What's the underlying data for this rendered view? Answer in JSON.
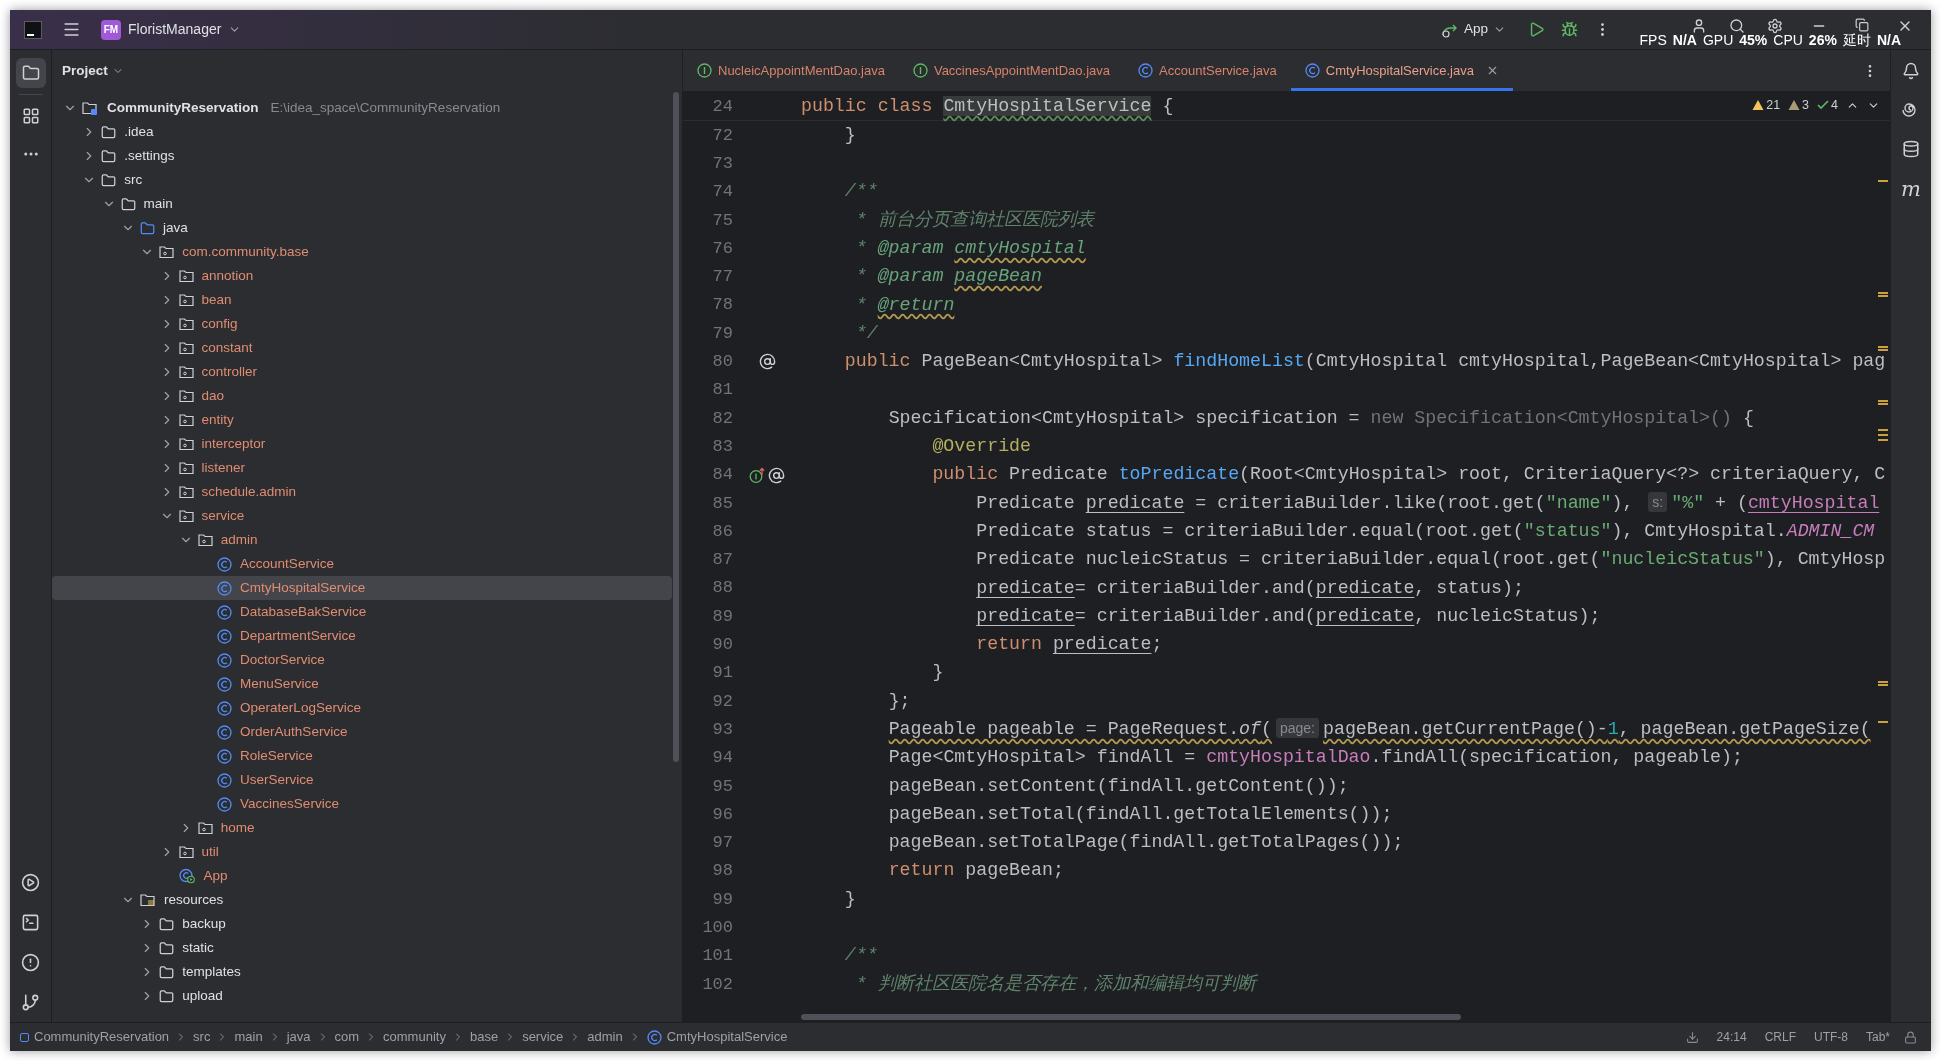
{
  "title_bar": {
    "project_badge": "FM",
    "project_name": "FloristManager",
    "run_config": "App"
  },
  "perf_overlay": [
    {
      "label": "FPS",
      "value": "N/A"
    },
    {
      "label": "GPU",
      "value": "45%"
    },
    {
      "label": "CPU",
      "value": "26%"
    },
    {
      "label": "延时",
      "value": "N/A"
    }
  ],
  "project_panel": {
    "title": "Project",
    "tree": [
      {
        "name": "CommunityReservation",
        "path": "E:\\idea_space\\CommunityReservation",
        "kind": "module",
        "color": "#dfe1e5",
        "expanded": true,
        "selected": false,
        "children": [
          {
            "name": ".idea",
            "kind": "folder",
            "color": "#dfe1e5",
            "expanded": false,
            "selected": false
          },
          {
            "name": ".settings",
            "kind": "folder",
            "color": "#dfe1e5",
            "expanded": false,
            "selected": false
          },
          {
            "name": "src",
            "kind": "folder",
            "color": "#dfe1e5",
            "expanded": true,
            "selected": false,
            "children": [
              {
                "name": "main",
                "kind": "folder",
                "color": "#dfe1e5",
                "expanded": true,
                "selected": false,
                "children": [
                  {
                    "name": "java",
                    "kind": "source-root",
                    "color": "#dfe1e5",
                    "expanded": true,
                    "selected": false,
                    "children": [
                      {
                        "name": "com.community.base",
                        "kind": "package",
                        "color": "#e08c73",
                        "expanded": true,
                        "selected": false,
                        "children": [
                          {
                            "name": "annotion",
                            "kind": "package",
                            "color": "#e08c73",
                            "expanded": false,
                            "selected": false
                          },
                          {
                            "name": "bean",
                            "kind": "package",
                            "color": "#e08c73",
                            "expanded": false,
                            "selected": false
                          },
                          {
                            "name": "config",
                            "kind": "package",
                            "color": "#e08c73",
                            "expanded": false,
                            "selected": false
                          },
                          {
                            "name": "constant",
                            "kind": "package",
                            "color": "#e08c73",
                            "expanded": false,
                            "selected": false
                          },
                          {
                            "name": "controller",
                            "kind": "package",
                            "color": "#e08c73",
                            "expanded": false,
                            "selected": false
                          },
                          {
                            "name": "dao",
                            "kind": "package",
                            "color": "#e08c73",
                            "expanded": false,
                            "selected": false
                          },
                          {
                            "name": "entity",
                            "kind": "package",
                            "color": "#e08c73",
                            "expanded": false,
                            "selected": false
                          },
                          {
                            "name": "interceptor",
                            "kind": "package",
                            "color": "#e08c73",
                            "expanded": false,
                            "selected": false
                          },
                          {
                            "name": "listener",
                            "kind": "package",
                            "color": "#e08c73",
                            "expanded": false,
                            "selected": false
                          },
                          {
                            "name": "schedule.admin",
                            "kind": "package",
                            "color": "#e08c73",
                            "expanded": false,
                            "selected": false
                          },
                          {
                            "name": "service",
                            "kind": "package",
                            "color": "#e08c73",
                            "expanded": true,
                            "selected": false,
                            "children": [
                              {
                                "name": "admin",
                                "kind": "package",
                                "color": "#e08c73",
                                "expanded": true,
                                "selected": false,
                                "children": [
                                  {
                                    "name": "AccountService",
                                    "kind": "class",
                                    "color": "#e08c73",
                                    "selected": false
                                  },
                                  {
                                    "name": "CmtyHospitalService",
                                    "kind": "class",
                                    "color": "#e08c73",
                                    "selected": true
                                  },
                                  {
                                    "name": "DatabaseBakService",
                                    "kind": "class",
                                    "color": "#e08c73",
                                    "selected": false
                                  },
                                  {
                                    "name": "DepartmentService",
                                    "kind": "class",
                                    "color": "#e08c73",
                                    "selected": false
                                  },
                                  {
                                    "name": "DoctorService",
                                    "kind": "class",
                                    "color": "#e08c73",
                                    "selected": false
                                  },
                                  {
                                    "name": "MenuService",
                                    "kind": "class",
                                    "color": "#e08c73",
                                    "selected": false
                                  },
                                  {
                                    "name": "OperaterLogService",
                                    "kind": "class",
                                    "color": "#e08c73",
                                    "selected": false
                                  },
                                  {
                                    "name": "OrderAuthService",
                                    "kind": "class",
                                    "color": "#e08c73",
                                    "selected": false
                                  },
                                  {
                                    "name": "RoleService",
                                    "kind": "class",
                                    "color": "#e08c73",
                                    "selected": false
                                  },
                                  {
                                    "name": "UserService",
                                    "kind": "class",
                                    "color": "#e08c73",
                                    "selected": false
                                  },
                                  {
                                    "name": "VaccinesService",
                                    "kind": "class",
                                    "color": "#e08c73",
                                    "selected": false
                                  }
                                ]
                              },
                              {
                                "name": "home",
                                "kind": "package",
                                "color": "#e08c73",
                                "expanded": false,
                                "selected": false
                              }
                            ]
                          },
                          {
                            "name": "util",
                            "kind": "package",
                            "color": "#e08c73",
                            "expanded": false,
                            "selected": false
                          },
                          {
                            "name": "App",
                            "kind": "app",
                            "color": "#e08c73",
                            "selected": false
                          }
                        ]
                      }
                    ]
                  },
                  {
                    "name": "resources",
                    "kind": "resource-root",
                    "color": "#dfe1e5",
                    "expanded": true,
                    "selected": false,
                    "children": [
                      {
                        "name": "backup",
                        "kind": "folder",
                        "color": "#dfe1e5",
                        "expanded": false,
                        "selected": false
                      },
                      {
                        "name": "static",
                        "kind": "folder",
                        "color": "#dfe1e5",
                        "expanded": false,
                        "selected": false
                      },
                      {
                        "name": "templates",
                        "kind": "folder",
                        "color": "#dfe1e5",
                        "expanded": false,
                        "selected": false
                      },
                      {
                        "name": "upload",
                        "kind": "folder",
                        "color": "#dfe1e5",
                        "expanded": false,
                        "selected": false
                      }
                    ]
                  }
                ]
              }
            ]
          }
        ]
      }
    ]
  },
  "tabs": [
    {
      "label": "NucleicAppointMentDao.java",
      "kind": "interface",
      "selected": false
    },
    {
      "label": "VaccinesAppointMentDao.java",
      "kind": "interface",
      "selected": false
    },
    {
      "label": "AccountService.java",
      "kind": "class",
      "selected": false
    },
    {
      "label": "CmtyHospitalService.java",
      "kind": "class",
      "selected": true
    }
  ],
  "inspections": [
    {
      "kind": "warning",
      "count": "21"
    },
    {
      "kind": "weak-warning",
      "count": "3"
    },
    {
      "kind": "typo",
      "count": "4"
    }
  ],
  "code_lines": [
    {
      "number": "24",
      "tokens": [
        {
          "kind": "keyword",
          "text": "public class "
        },
        {
          "kind": "highlighted",
          "text": "CmtyHospitalService"
        },
        {
          "kind": "plain",
          "text": " {"
        }
      ]
    },
    {
      "number": "72",
      "tokens": [
        {
          "kind": "plain",
          "text": "    }"
        }
      ]
    },
    {
      "number": "73"
    },
    {
      "number": "74",
      "tokens": [
        {
          "kind": "doc",
          "text": "    /**"
        }
      ]
    },
    {
      "number": "75",
      "tokens": [
        {
          "kind": "doc",
          "text": "     * 前台分页查询社区医院列表"
        }
      ]
    },
    {
      "number": "76",
      "tokens": [
        {
          "kind": "doc",
          "text": "     * "
        },
        {
          "kind": "doc-tag",
          "text": "@param "
        },
        {
          "kind": "doc-param",
          "text": "cmtyHospital"
        }
      ]
    },
    {
      "number": "77",
      "tokens": [
        {
          "kind": "doc",
          "text": "     * "
        },
        {
          "kind": "doc-tag",
          "text": "@param "
        },
        {
          "kind": "doc-param",
          "text": "pageBean"
        }
      ]
    },
    {
      "number": "78",
      "tokens": [
        {
          "kind": "doc",
          "text": "     * "
        },
        {
          "kind": "doc-tag-warned",
          "text": "@return"
        }
      ]
    },
    {
      "number": "79",
      "tokens": [
        {
          "kind": "doc",
          "text": "     */"
        }
      ]
    },
    {
      "number": "80",
      "gutter": [
        {
          "kind": "at"
        }
      ],
      "tokens": [
        {
          "kind": "keyword",
          "text": "    public "
        },
        {
          "kind": "plain",
          "text": "PageBean<CmtyHospital> "
        },
        {
          "kind": "method",
          "text": "findHomeList"
        },
        {
          "kind": "plain",
          "text": "(CmtyHospital cmtyHospital,PageBean<CmtyHospital> pag"
        }
      ]
    },
    {
      "number": "81"
    },
    {
      "number": "82",
      "tokens": [
        {
          "kind": "plain",
          "text": "        Specification<CmtyHospital> specification = "
        },
        {
          "kind": "muted",
          "text": "new Specification<CmtyHospital>()"
        },
        {
          "kind": "plain",
          "text": " {"
        }
      ]
    },
    {
      "number": "83",
      "tokens": [
        {
          "kind": "annotation",
          "text": "            @Override"
        }
      ]
    },
    {
      "number": "84",
      "gutter": [
        {
          "kind": "implements"
        },
        {
          "kind": "at"
        }
      ],
      "tokens": [
        {
          "kind": "keyword",
          "text": "            public "
        },
        {
          "kind": "plain",
          "text": "Predicate "
        },
        {
          "kind": "method",
          "text": "toPredicate"
        },
        {
          "kind": "plain",
          "text": "(Root<CmtyHospital> root, CriteriaQuery<?> criteriaQuery, C"
        }
      ]
    },
    {
      "number": "85",
      "tokens": [
        {
          "kind": "plain",
          "text": "                Predicate "
        },
        {
          "kind": "reassigned",
          "text": "predicate"
        },
        {
          "kind": "plain",
          "text": " = criteriaBuilder.like(root.get("
        },
        {
          "kind": "string",
          "text": "\"name\""
        },
        {
          "kind": "plain",
          "text": "), "
        },
        {
          "kind": "hint",
          "text": "s:"
        },
        {
          "kind": "string",
          "text": "\"%\""
        },
        {
          "kind": "plain",
          "text": " + ("
        },
        {
          "kind": "field-ref",
          "text": "cmtyHospital"
        }
      ]
    },
    {
      "number": "86",
      "tokens": [
        {
          "kind": "plain",
          "text": "                Predicate status = criteriaBuilder.equal(root.get("
        },
        {
          "kind": "string",
          "text": "\"status\""
        },
        {
          "kind": "plain",
          "text": "), CmtyHospital."
        },
        {
          "kind": "constant",
          "text": "ADMIN_CM"
        }
      ]
    },
    {
      "number": "87",
      "tokens": [
        {
          "kind": "plain",
          "text": "                Predicate nucleicStatus = criteriaBuilder.equal(root.get("
        },
        {
          "kind": "string",
          "text": "\"nucleicStatus\""
        },
        {
          "kind": "plain",
          "text": "), CmtyHosp"
        }
      ]
    },
    {
      "number": "88",
      "tokens": [
        {
          "kind": "reassigned",
          "text": "                predicate"
        },
        {
          "kind": "plain",
          "text": "= criteriaBuilder.and("
        },
        {
          "kind": "reassigned",
          "text": "predicate"
        },
        {
          "kind": "plain",
          "text": ", status);"
        }
      ]
    },
    {
      "number": "89",
      "tokens": [
        {
          "kind": "reassigned",
          "text": "                predicate"
        },
        {
          "kind": "plain",
          "text": "= criteriaBuilder.and("
        },
        {
          "kind": "reassigned",
          "text": "predicate"
        },
        {
          "kind": "plain",
          "text": ", nucleicStatus);"
        }
      ]
    },
    {
      "number": "90",
      "tokens": [
        {
          "kind": "keyword",
          "text": "                return "
        },
        {
          "kind": "reassigned",
          "text": "predicate"
        },
        {
          "kind": "plain",
          "text": ";"
        }
      ]
    },
    {
      "number": "91",
      "tokens": [
        {
          "kind": "plain",
          "text": "            }"
        }
      ]
    },
    {
      "number": "92",
      "tokens": [
        {
          "kind": "plain",
          "text": "        };"
        }
      ]
    },
    {
      "number": "93",
      "tokens": [
        {
          "kind": "warned",
          "text": "        Pageable pageable = PageRequest."
        },
        {
          "kind": "warned-static",
          "text": "of"
        },
        {
          "kind": "warned",
          "text": "("
        },
        {
          "kind": "hint",
          "text": "page:"
        },
        {
          "kind": "warned",
          "text": "pageBean.getCurrentPage()-"
        },
        {
          "kind": "warned-number",
          "text": "1"
        },
        {
          "kind": "warned",
          "text": ", pageBean.getPageSize("
        }
      ]
    },
    {
      "number": "94",
      "tokens": [
        {
          "kind": "plain",
          "text": "        Page<CmtyHospital> findAll = "
        },
        {
          "kind": "field",
          "text": "cmtyHospitalDao"
        },
        {
          "kind": "plain",
          "text": ".findAll(specification, pageable);"
        }
      ]
    },
    {
      "number": "95",
      "tokens": [
        {
          "kind": "plain",
          "text": "        pageBean.setContent(findAll.getContent());"
        }
      ]
    },
    {
      "number": "96",
      "tokens": [
        {
          "kind": "plain",
          "text": "        pageBean.setTotal(findAll.getTotalElements());"
        }
      ]
    },
    {
      "number": "97",
      "tokens": [
        {
          "kind": "plain",
          "text": "        pageBean.setTotalPage(findAll.getTotalPages());"
        }
      ]
    },
    {
      "number": "98",
      "tokens": [
        {
          "kind": "keyword",
          "text": "        return "
        },
        {
          "kind": "plain",
          "text": "pageBean;"
        }
      ]
    },
    {
      "number": "99",
      "tokens": [
        {
          "kind": "plain",
          "text": "    }"
        }
      ]
    },
    {
      "number": "100"
    },
    {
      "number": "101",
      "tokens": [
        {
          "kind": "doc",
          "text": "    /**"
        }
      ]
    },
    {
      "number": "102",
      "tokens": [
        {
          "kind": "doc",
          "text": "     * 判断社区医院名是否存在，添加和编辑均可判断"
        }
      ]
    }
  ],
  "right_toolbar_text": "m",
  "status_bar": {
    "breadcrumbs": [
      {
        "label": "CommunityReservation",
        "kind": "module"
      },
      {
        "label": "src",
        "kind": "folder"
      },
      {
        "label": "main",
        "kind": "folder"
      },
      {
        "label": "java",
        "kind": "folder"
      },
      {
        "label": "com",
        "kind": "folder"
      },
      {
        "label": "community",
        "kind": "folder"
      },
      {
        "label": "base",
        "kind": "folder"
      },
      {
        "label": "service",
        "kind": "folder"
      },
      {
        "label": "admin",
        "kind": "folder"
      },
      {
        "label": "CmtyHospitalService",
        "kind": "class"
      }
    ],
    "position": "24:14",
    "line_separator": "CRLF",
    "encoding": "UTF-8",
    "indent": "Tab*"
  }
}
